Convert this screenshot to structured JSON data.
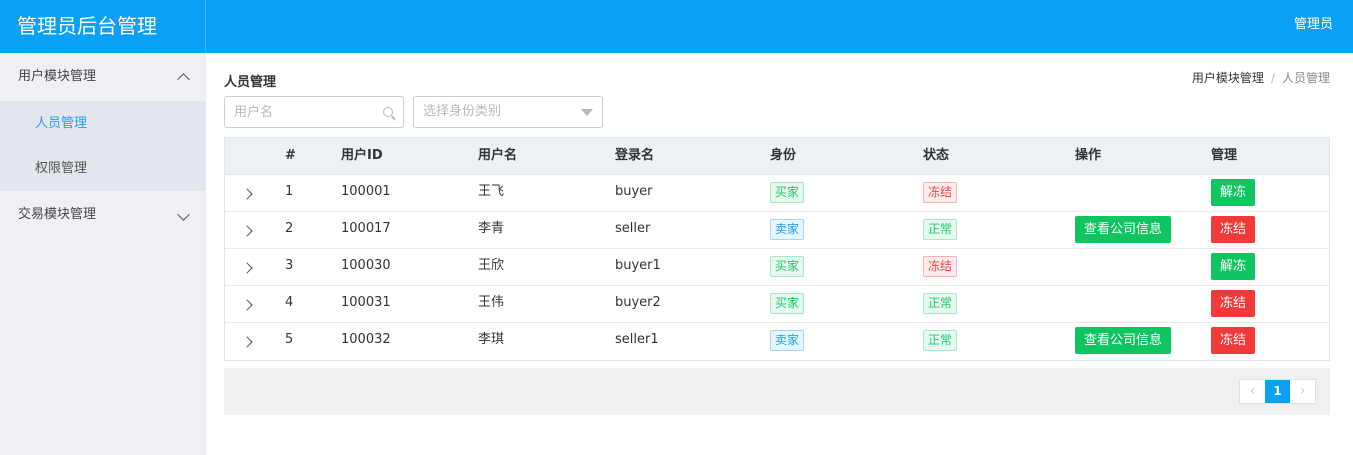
{
  "app": {
    "title": "管理员后台管理",
    "user": "管理员"
  },
  "sidebar": {
    "groups": [
      {
        "label": "用户模块管理",
        "expanded": true,
        "items": [
          {
            "label": "人员管理",
            "active": true
          },
          {
            "label": "权限管理",
            "active": false
          }
        ]
      },
      {
        "label": "交易模块管理",
        "expanded": false,
        "items": []
      }
    ]
  },
  "page": {
    "title": "人员管理",
    "breadcrumb": [
      "用户模块管理",
      "人员管理"
    ]
  },
  "filters": {
    "username_placeholder": "用户名",
    "identity_placeholder": "选择身份类别"
  },
  "table": {
    "columns": [
      "#",
      "用户ID",
      "用户名",
      "登录名",
      "身份",
      "状态",
      "操作",
      "管理"
    ],
    "rows": [
      {
        "no": "1",
        "id": "100001",
        "name": "王飞",
        "login": "buyer",
        "identity": "买家",
        "identity_type": "buyer",
        "status": "冻结",
        "status_type": "frozen",
        "action": "",
        "manage": "解冻",
        "manage_type": "green"
      },
      {
        "no": "2",
        "id": "100017",
        "name": "李青",
        "login": "seller",
        "identity": "卖家",
        "identity_type": "seller",
        "status": "正常",
        "status_type": "normal",
        "action": "查看公司信息",
        "manage": "冻结",
        "manage_type": "red"
      },
      {
        "no": "3",
        "id": "100030",
        "name": "王欣",
        "login": "buyer1",
        "identity": "买家",
        "identity_type": "buyer",
        "status": "冻结",
        "status_type": "frozen",
        "action": "",
        "manage": "解冻",
        "manage_type": "green"
      },
      {
        "no": "4",
        "id": "100031",
        "name": "王伟",
        "login": "buyer2",
        "identity": "买家",
        "identity_type": "buyer",
        "status": "正常",
        "status_type": "normal",
        "action": "",
        "manage": "冻结",
        "manage_type": "red"
      },
      {
        "no": "5",
        "id": "100032",
        "name": "李琪",
        "login": "seller1",
        "identity": "卖家",
        "identity_type": "seller",
        "status": "正常",
        "status_type": "normal",
        "action": "查看公司信息",
        "manage": "冻结",
        "manage_type": "red"
      }
    ]
  },
  "pagination": {
    "pages": [
      "1"
    ],
    "current": "1",
    "prev": "‹",
    "next": "›"
  },
  "colors": {
    "primary": "#0aa0f5",
    "success": "#0ec562",
    "danger": "#f03a3a"
  }
}
